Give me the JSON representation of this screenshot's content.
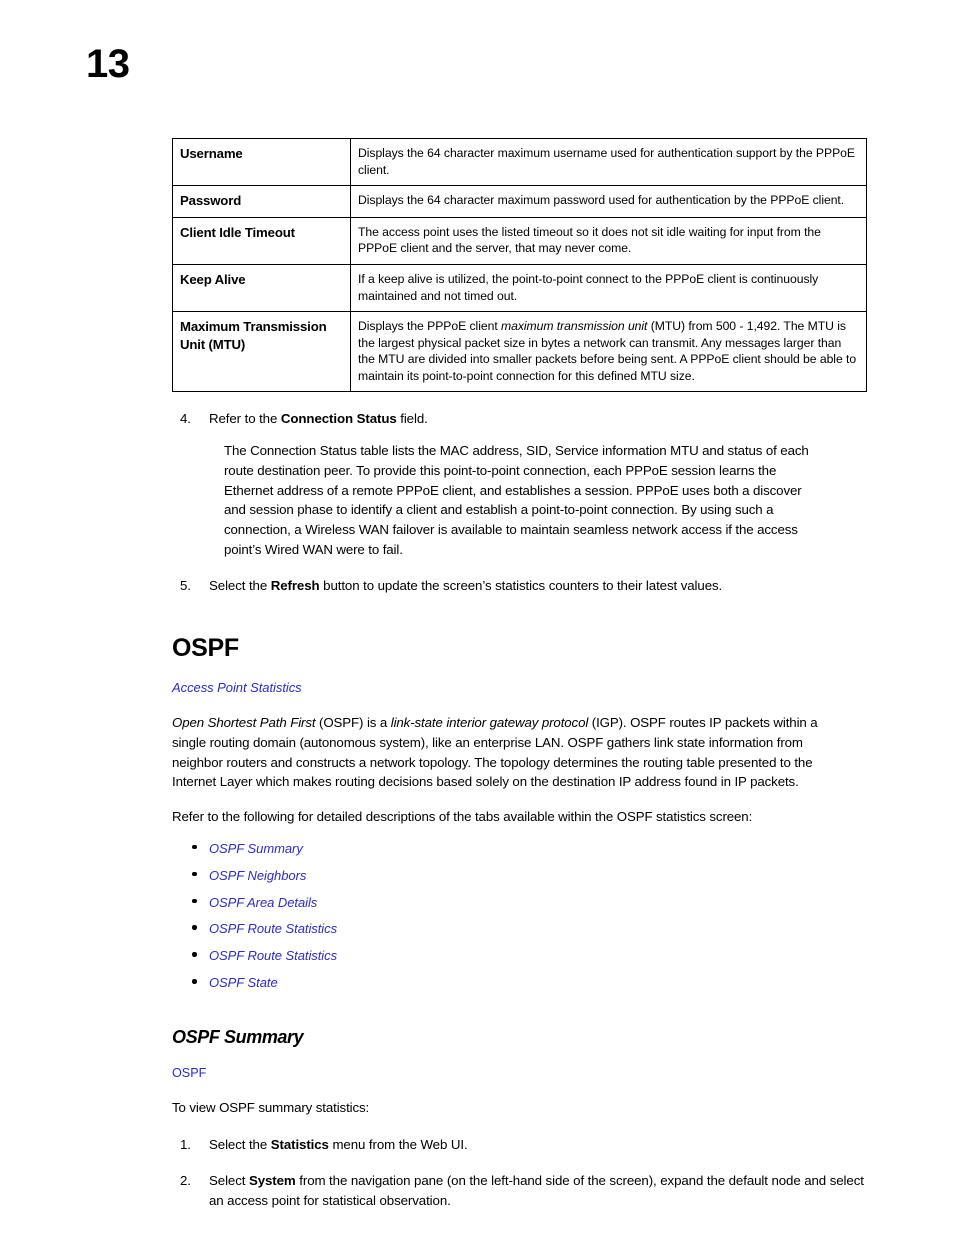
{
  "page": {
    "number": "13"
  },
  "param_table": {
    "rows": [
      {
        "term": "Username",
        "desc_html": "Displays the 64 character maximum username used for authentication support by the PPPoE client."
      },
      {
        "term": "Password",
        "desc_html": "Displays the 64 character maximum password used for authentication by the PPPoE client."
      },
      {
        "term": "Client Idle Timeout",
        "desc_html": "The access point uses the listed timeout so it does not sit idle waiting for input from the PPPoE client and the server, that may never come."
      },
      {
        "term": "Keep Alive",
        "desc_html": "If a keep alive is utilized, the point-to-point connect to the PPPoE client is continuously maintained and not timed out."
      },
      {
        "term": "Maximum Transmission Unit (MTU)",
        "desc_html": "Displays the PPPoE client <i>maximum transmission unit</i> (MTU) from 500 - 1,492. The MTU is the largest physical packet size in bytes a network can transmit. Any messages larger than the MTU are divided into smaller packets before being sent. A PPPoE client should be able to maintain its point-to-point connection for this defined MTU size."
      }
    ]
  },
  "steps_pppoe": {
    "item4": {
      "number": "4.",
      "text_html": "Refer to the <b>Connection Status</b> field.",
      "sub_paragraph": "The Connection Status table lists the MAC address, SID, Service information MTU and status of each route destination peer. To provide this point-to-point connection, each PPPoE session learns the Ethernet address of a remote PPPoE client, and establishes a session. PPPoE uses both a discover and session phase to identify a client and establish a point-to-point connection. By using such a connection, a Wireless WAN failover is available to maintain seamless network access if the access point’s Wired WAN were to fail."
    },
    "item5": {
      "number": "5.",
      "text_html": "Select the <b>Refresh</b> button to update the screen’s statistics counters to their latest values."
    }
  },
  "ospf_section": {
    "heading": "OSPF",
    "breadcrumb_link": "Access Point Statistics",
    "intro_html": "<i>Open Shortest Path First</i> (OSPF) is a <i>link-state interior gateway protocol</i> (IGP). OSPF routes IP packets within a single routing domain (autonomous system), like an enterprise LAN. OSPF gathers link state information from neighbor routers and constructs a network topology. The topology determines the routing table presented to the Internet Layer which makes routing decisions based solely on the destination IP address found in IP packets.",
    "refer_text": "Refer to the following for detailed descriptions of the tabs available within the OSPF statistics screen:",
    "tab_links": [
      "OSPF Summary",
      "OSPF Neighbors",
      "OSPF Area Details",
      "OSPF Route Statistics",
      "OSPF Route Statistics",
      "OSPF State"
    ]
  },
  "ospf_summary_section": {
    "heading": "OSPF Summary",
    "breadcrumb_link": "OSPF",
    "lead_in": "To view OSPF summary statistics:",
    "steps": [
      {
        "number": "1.",
        "text_html": "Select the <b>Statistics</b> menu from the Web UI."
      },
      {
        "number": "2.",
        "text_html": "Select <b>System</b> from the navigation pane (on the left-hand side of the screen), expand the default node and select an access point for statistical observation."
      }
    ]
  },
  "colors": {
    "link": "#2a2ad0",
    "text": "#000000",
    "border": "#000000"
  }
}
